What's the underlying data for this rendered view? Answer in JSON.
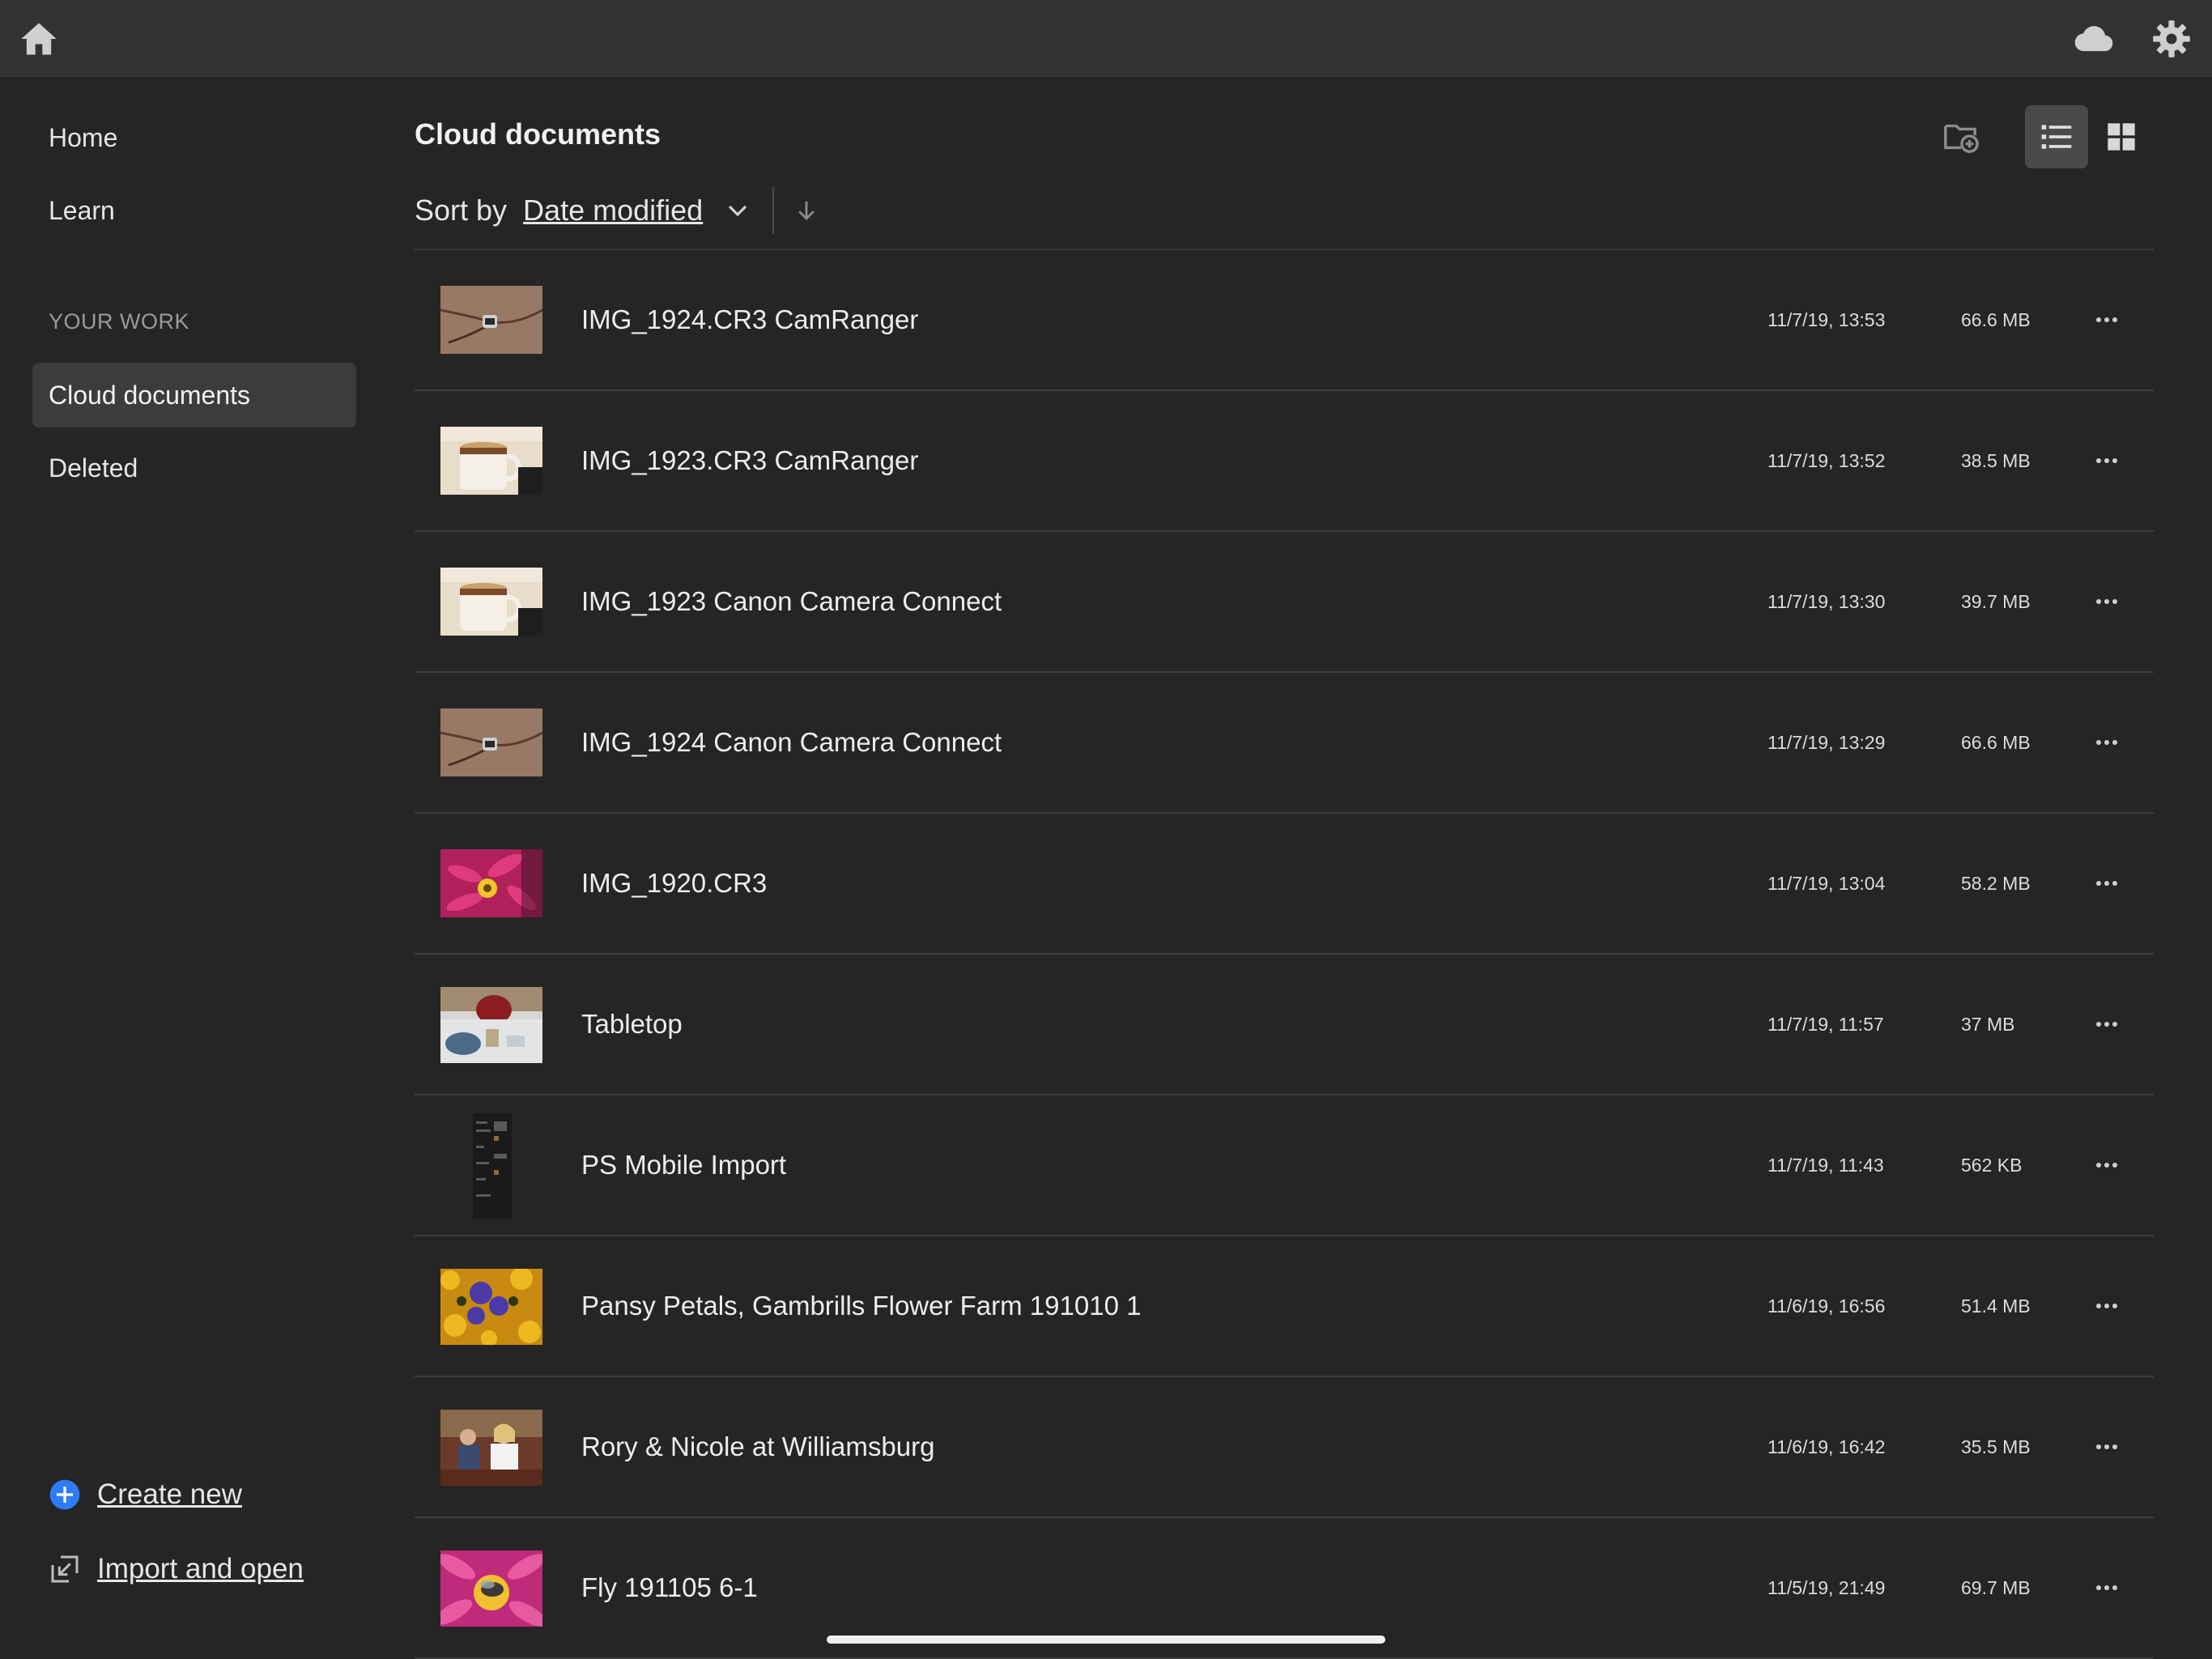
{
  "topbar": {
    "left_icon": "home-icon",
    "right_icons": [
      "cloud-icon",
      "gear-icon"
    ]
  },
  "sidebar": {
    "nav": [
      {
        "label": "Home"
      },
      {
        "label": "Learn"
      }
    ],
    "section_label": "YOUR WORK",
    "work_items": [
      {
        "label": "Cloud documents",
        "active": true
      },
      {
        "label": "Deleted",
        "active": false
      }
    ],
    "create_new": {
      "label": "Create new",
      "icon": "plus-circle-icon",
      "color": "#2d7cf6"
    },
    "import_open": {
      "label": "Import and open",
      "icon": "import-icon"
    }
  },
  "main": {
    "title": "Cloud documents",
    "sort": {
      "label": "Sort by",
      "value": "Date modified",
      "direction": "descending"
    },
    "view_buttons": [
      {
        "icon": "new-folder-icon"
      },
      {
        "icon": "list-view-icon",
        "active": true
      },
      {
        "icon": "grid-view-icon",
        "active": false
      }
    ],
    "documents": [
      {
        "name": "IMG_1924.CR3 CamRanger",
        "date": "11/7/19, 13:53",
        "size": "66.6 MB",
        "thumb": "camera-strap"
      },
      {
        "name": "IMG_1923.CR3 CamRanger",
        "date": "11/7/19, 13:52",
        "size": "38.5 MB",
        "thumb": "mug"
      },
      {
        "name": "IMG_1923 Canon Camera Connect",
        "date": "11/7/19, 13:30",
        "size": "39.7 MB",
        "thumb": "mug"
      },
      {
        "name": "IMG_1924 Canon Camera Connect",
        "date": "11/7/19, 13:29",
        "size": "66.6 MB",
        "thumb": "camera-strap"
      },
      {
        "name": "IMG_1920.CR3",
        "date": "11/7/19, 13:04",
        "size": "58.2 MB",
        "thumb": "pink-flower"
      },
      {
        "name": "Tabletop",
        "date": "11/7/19, 11:57",
        "size": "37 MB",
        "thumb": "tabletop"
      },
      {
        "name": "PS Mobile Import",
        "date": "11/7/19, 11:43",
        "size": "562 KB",
        "thumb": "screenshot"
      },
      {
        "name": "Pansy Petals, Gambrills Flower Farm 191010 1",
        "date": "11/6/19, 16:56",
        "size": "51.4 MB",
        "thumb": "pansies"
      },
      {
        "name": "Rory & Nicole at Williamsburg",
        "date": "11/6/19, 16:42",
        "size": "35.5 MB",
        "thumb": "people"
      },
      {
        "name": "Fly 191105 6-1",
        "date": "11/5/19, 21:49",
        "size": "69.7 MB",
        "thumb": "fly-flower"
      }
    ]
  },
  "colors": {
    "background": "#252525",
    "topbar": "#323232",
    "accent": "#2d7cf6"
  }
}
